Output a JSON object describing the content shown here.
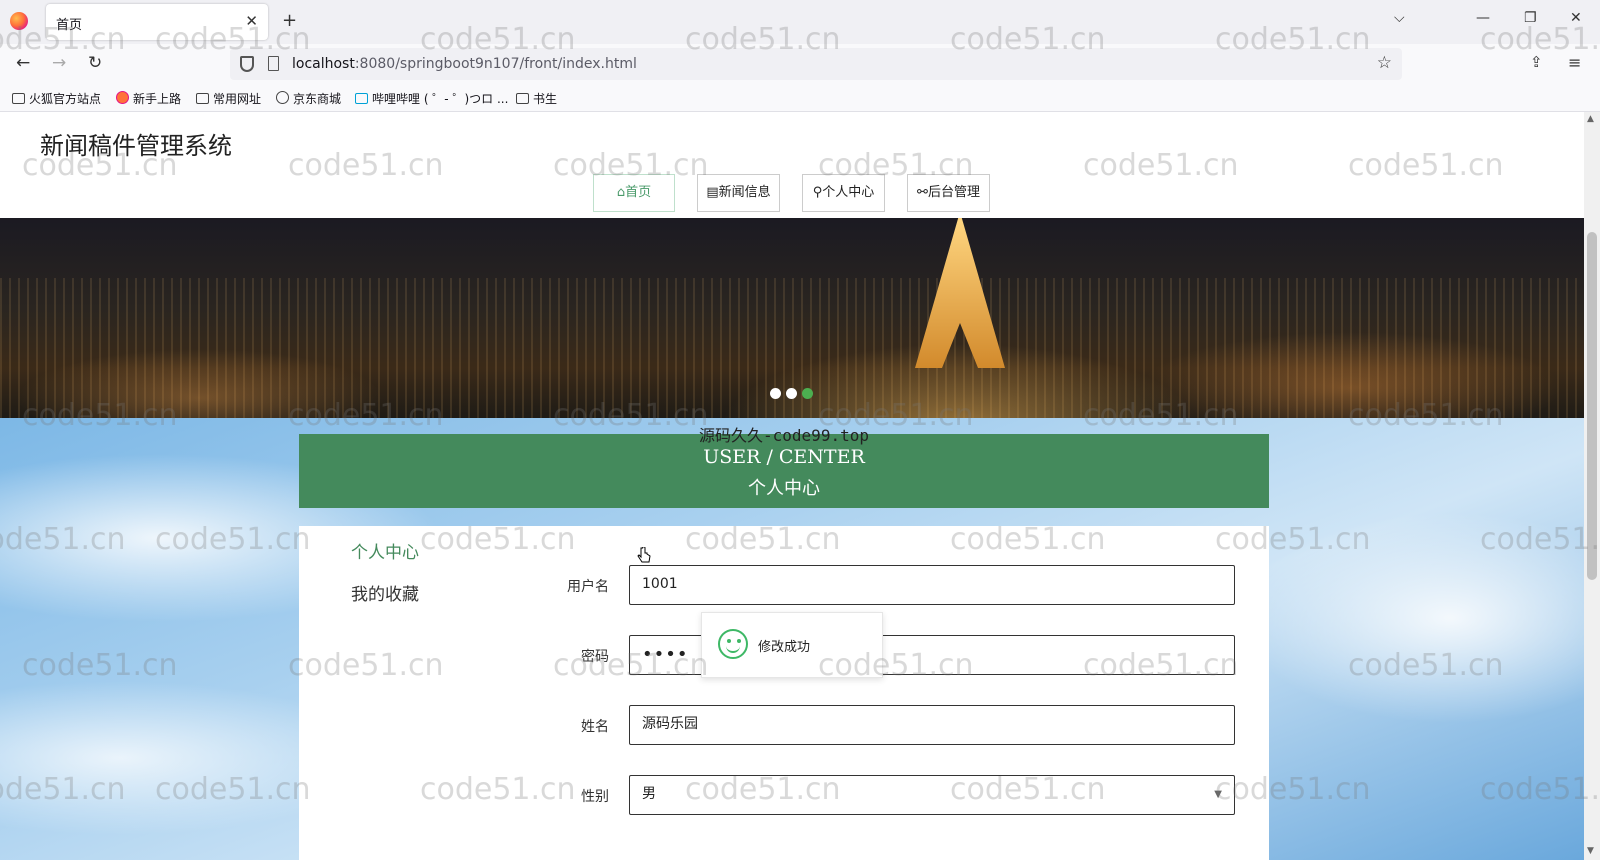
{
  "browser": {
    "tab_title": "首页",
    "tab_close": "✕",
    "new_tab": "+",
    "url_host": "localhost",
    "url_rest": ":8080/springboot9n107/front/index.html",
    "bookmarks": [
      "火狐官方站点",
      "新手上路",
      "常用网址",
      "京东商城",
      "哔哩哔哩 ( ゜- ゜)つロ ...",
      "书生"
    ]
  },
  "site": {
    "title": "新闻稿件管理系统",
    "menu": [
      {
        "label": "首页",
        "icon": "home-icon",
        "active": true
      },
      {
        "label": "新闻信息",
        "icon": "gift-icon",
        "active": false
      },
      {
        "label": "个人中心",
        "icon": "user-icon",
        "active": false
      },
      {
        "label": "后台管理",
        "icon": "link-icon",
        "active": false
      }
    ],
    "carousel": {
      "slides": 3,
      "active_index": 2
    }
  },
  "user_center": {
    "overlay": "源码久久-code99.top",
    "title_en": "USER / CENTER",
    "title_zh": "个人中心",
    "side_menu": [
      {
        "label": "个人中心",
        "active": true
      },
      {
        "label": "我的收藏",
        "active": false
      }
    ],
    "form": {
      "username_label": "用户名",
      "username_value": "1001",
      "password_label": "密码",
      "password_value": "••••",
      "name_label": "姓名",
      "name_value": "源码乐园",
      "gender_label": "性别",
      "gender_value": "男"
    }
  },
  "toast": {
    "text": "修改成功",
    "icon": "smile-icon",
    "color": "#3eb866"
  },
  "watermark": "code51.cn",
  "colors": {
    "accent": "#448a5c",
    "active_dot": "#4caf50"
  }
}
